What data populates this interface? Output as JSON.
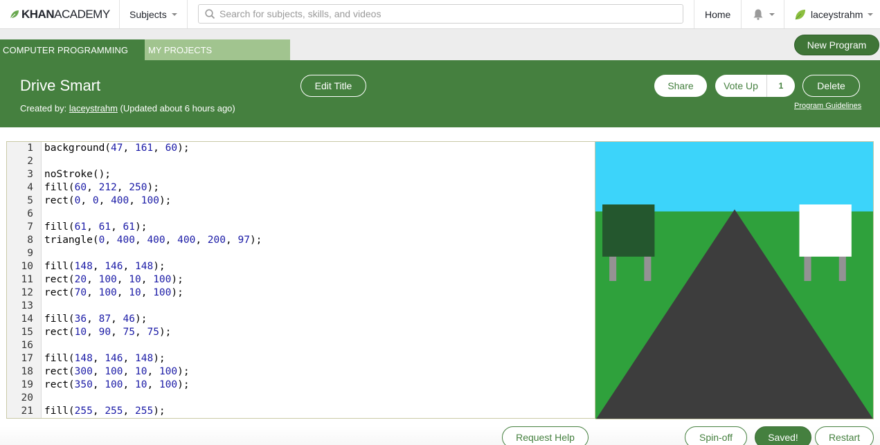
{
  "nav": {
    "logo_bold": "KHAN",
    "logo_light": "ACADEMY",
    "subjects_label": "Subjects",
    "search_placeholder": "Search for subjects, skills, and videos",
    "home_label": "Home",
    "username": "laceystrahm"
  },
  "breadcrumb": {
    "section": "COMPUTER PROGRAMMING",
    "subsection": "MY PROJECTS"
  },
  "new_program_label": "New Program",
  "program": {
    "title": "Drive Smart",
    "created_prefix": "Created by: ",
    "author": "laceystrahm",
    "updated": " (Updated about 6 hours ago)",
    "edit_title_label": "Edit Title",
    "share_label": "Share",
    "vote_label": "Vote Up",
    "vote_count": "1",
    "delete_label": "Delete",
    "guidelines_label": "Program Guidelines"
  },
  "code_lines": [
    "background(47, 161, 60);",
    "",
    "noStroke();",
    "fill(60, 212, 250);",
    "rect(0, 0, 400, 100);",
    "",
    "fill(61, 61, 61);",
    "triangle(0, 400, 400, 400, 200, 97);",
    "",
    "fill(148, 146, 148);",
    "rect(20, 100, 10, 100);",
    "rect(70, 100, 10, 100);",
    "",
    "fill(36, 87, 46);",
    "rect(10, 90, 75, 75);",
    "",
    "fill(148, 146, 148);",
    "rect(300, 100, 10, 100);",
    "rect(350, 100, 10, 100);",
    "",
    "fill(255, 255, 255);"
  ],
  "bottom": {
    "request_help_label": "Request Help",
    "spinoff_label": "Spin-off",
    "saved_label": "Saved!",
    "restart_label": "Restart"
  },
  "colors": {
    "brand_green": "#45803f",
    "light_green_tab": "#a1c48f",
    "number_blue": "#1a1aa6"
  },
  "icons": [
    "leaf-logo-icon",
    "search-icon",
    "bell-icon",
    "leaf-avatar-icon",
    "chevron-down-icon"
  ]
}
